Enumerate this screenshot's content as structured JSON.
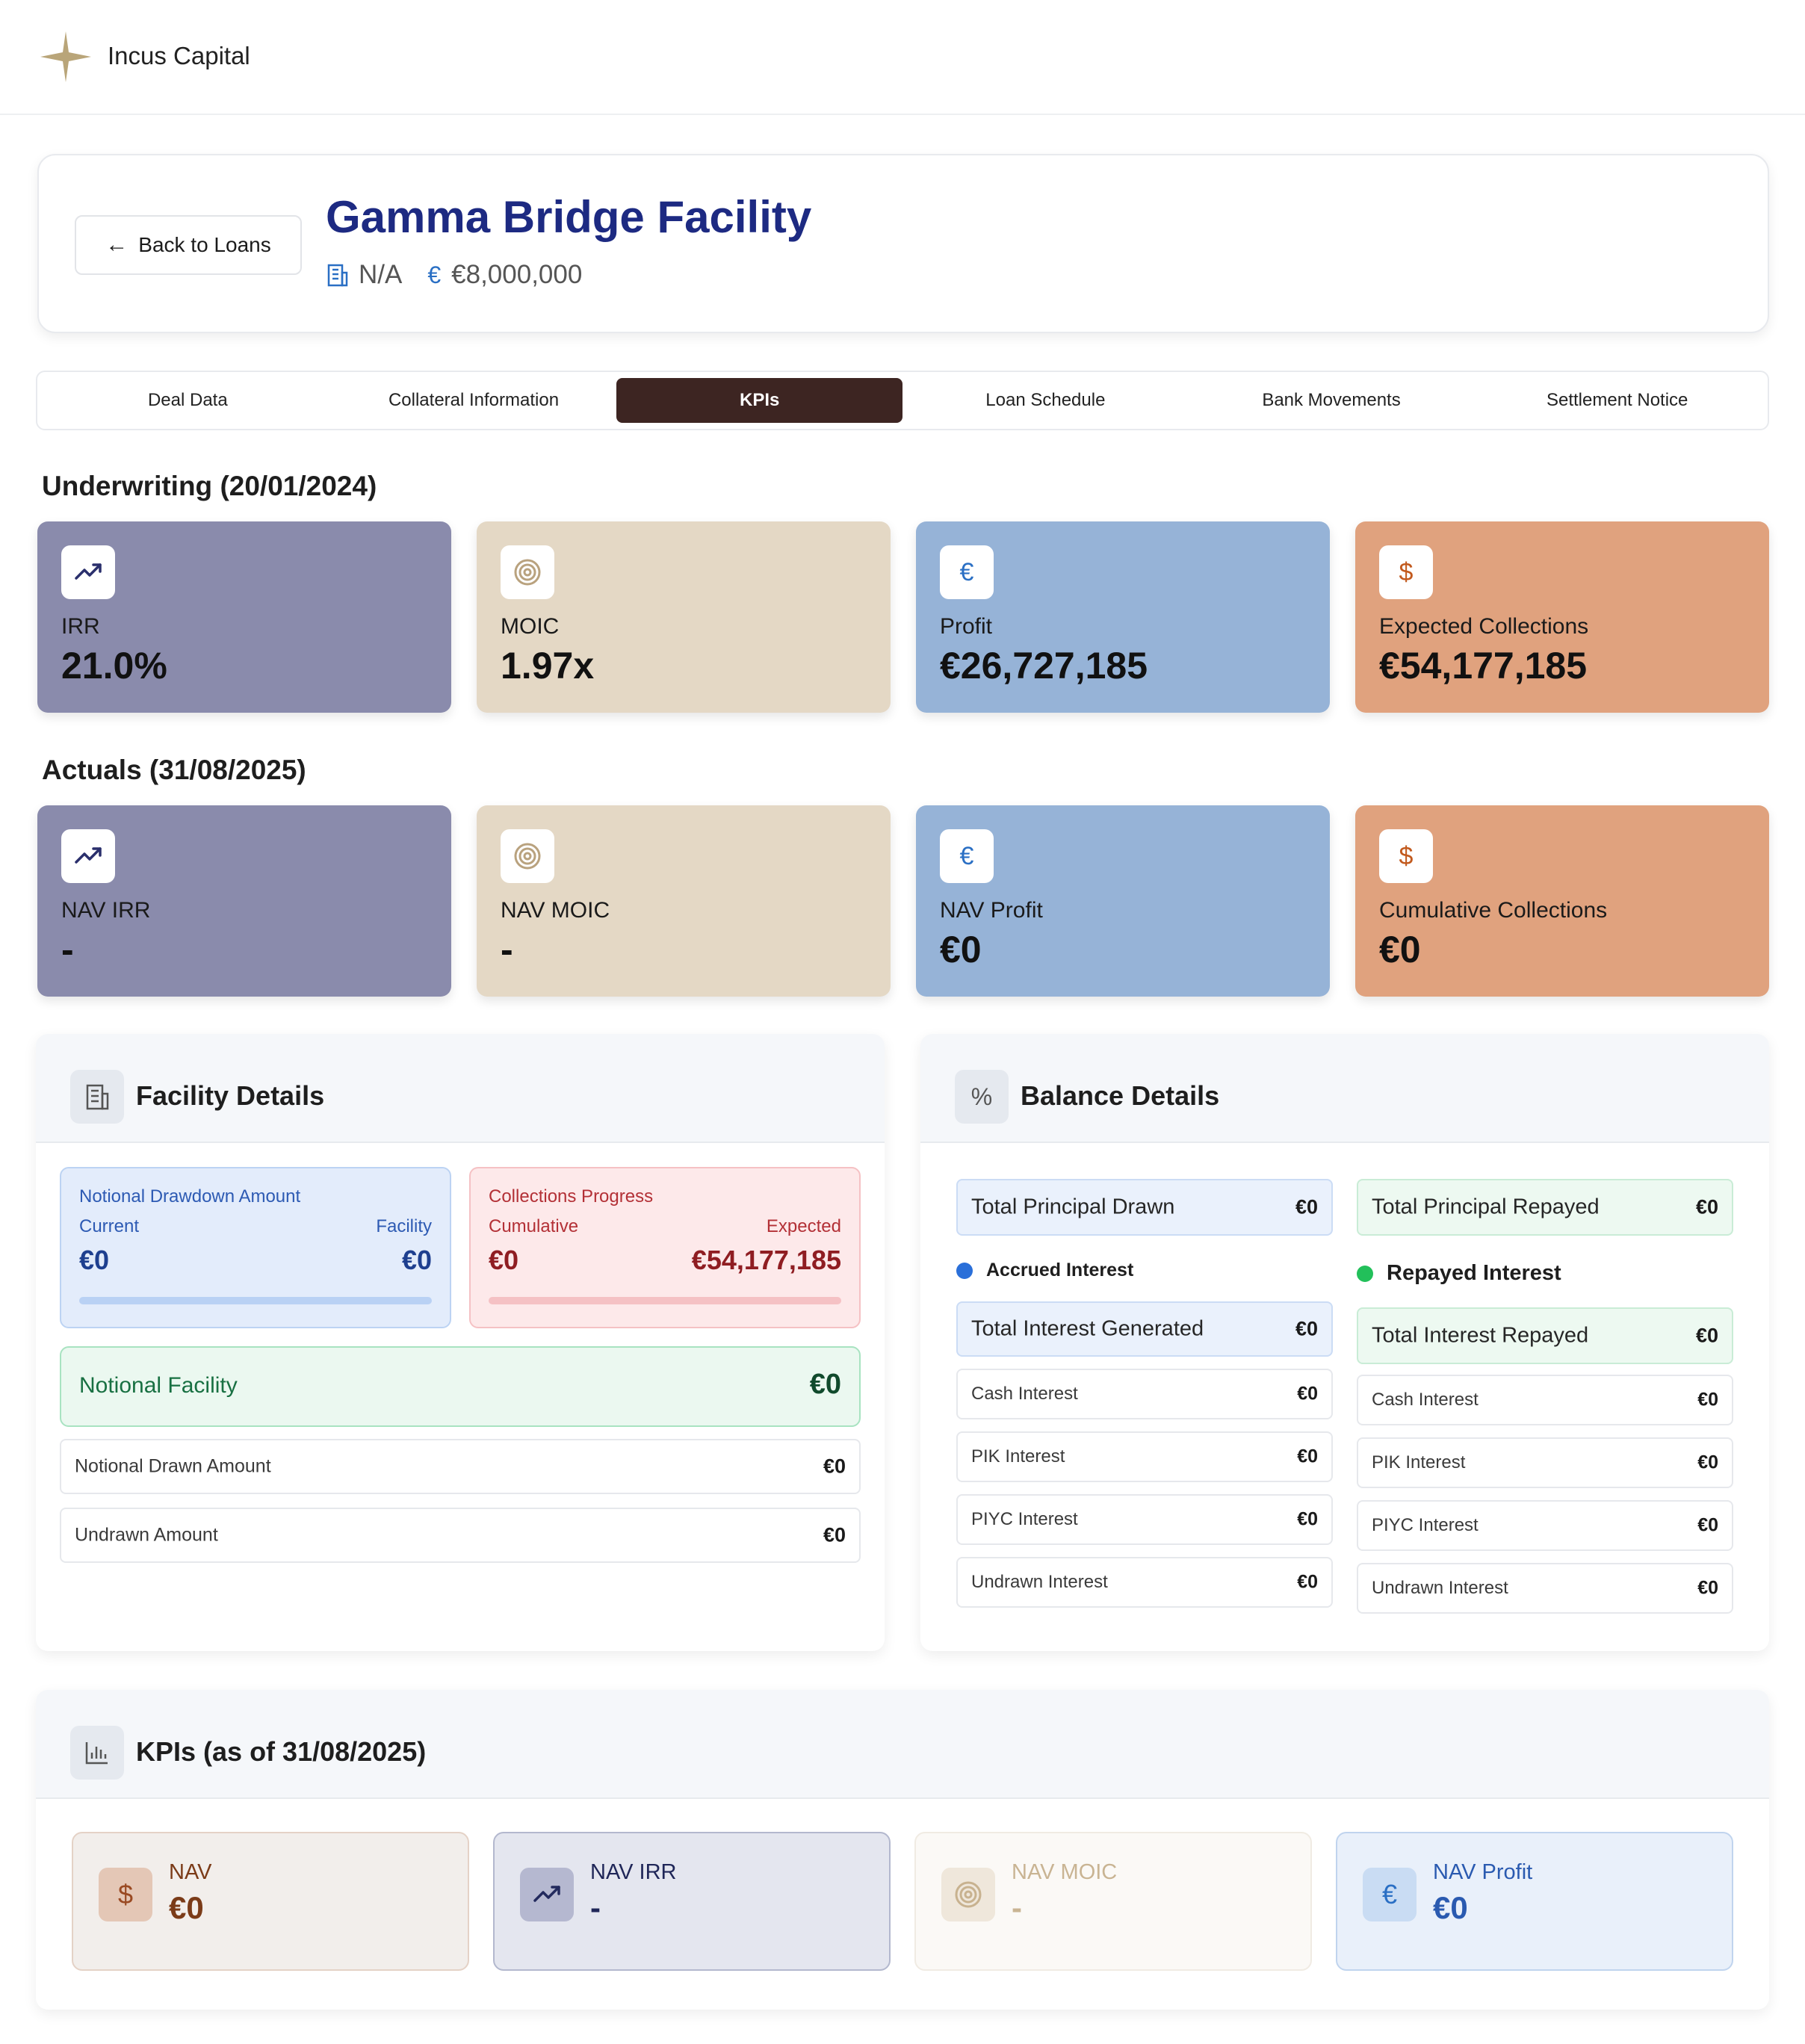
{
  "app": {
    "brand": "Incus Capital"
  },
  "header": {
    "back_label": "Back to Loans",
    "title": "Gamma Bridge Facility",
    "meta_code": "N/A",
    "meta_amount": "€8,000,000"
  },
  "tabs": [
    "Deal Data",
    "Collateral Information",
    "KPIs",
    "Loan Schedule",
    "Bank Movements",
    "Settlement Notice"
  ],
  "active_tab": "KPIs",
  "underwriting": {
    "heading": "Underwriting (20/01/2024)",
    "cards": [
      {
        "label": "IRR",
        "value": "21.0%",
        "icon": "trend-up-icon"
      },
      {
        "label": "MOIC",
        "value": "1.97x",
        "icon": "target-icon"
      },
      {
        "label": "Profit",
        "value": "€26,727,185",
        "icon": "euro-icon"
      },
      {
        "label": "Expected Collections",
        "value": "€54,177,185",
        "icon": "dollar-icon"
      }
    ]
  },
  "actuals": {
    "heading": "Actuals (31/08/2025)",
    "cards": [
      {
        "label": "NAV IRR",
        "value": "-",
        "icon": "trend-up-icon"
      },
      {
        "label": "NAV MOIC",
        "value": "-",
        "icon": "target-icon"
      },
      {
        "label": "NAV Profit",
        "value": "€0",
        "icon": "euro-icon"
      },
      {
        "label": "Cumulative Collections",
        "value": "€0",
        "icon": "dollar-icon"
      }
    ]
  },
  "facility": {
    "title": "Facility Details",
    "drawdown": {
      "title": "Notional Drawdown Amount",
      "left_sub": "Current",
      "right_sub": "Facility",
      "left_val": "€0",
      "right_val": "€0",
      "progress": 0
    },
    "collections": {
      "title": "Collections Progress",
      "left_sub": "Cumulative",
      "right_sub": "Expected",
      "left_val": "€0",
      "right_val": "€54,177,185",
      "progress": 0
    },
    "notional": {
      "label": "Notional Facility",
      "value": "€0"
    },
    "rows": [
      {
        "label": "Notional Drawn Amount",
        "value": "€0"
      },
      {
        "label": "Undrawn Amount",
        "value": "€0"
      }
    ]
  },
  "balance": {
    "title": "Balance Details",
    "principal_drawn": {
      "label": "Total Principal Drawn",
      "value": "€0"
    },
    "principal_repayed": {
      "label": "Total Principal Repayed",
      "value": "€0"
    },
    "accrued": {
      "heading": "Accrued Interest",
      "total": {
        "label": "Total Interest Generated",
        "value": "€0"
      },
      "rows": [
        {
          "label": "Cash Interest",
          "value": "€0"
        },
        {
          "label": "PIK Interest",
          "value": "€0"
        },
        {
          "label": "PIYC Interest",
          "value": "€0"
        },
        {
          "label": "Undrawn Interest",
          "value": "€0"
        }
      ]
    },
    "repayed": {
      "heading": "Repayed Interest",
      "total": {
        "label": "Total Interest Repayed",
        "value": "€0"
      },
      "rows": [
        {
          "label": "Cash Interest",
          "value": "€0"
        },
        {
          "label": "PIK Interest",
          "value": "€0"
        },
        {
          "label": "PIYC Interest",
          "value": "€0"
        },
        {
          "label": "Undrawn Interest",
          "value": "€0"
        }
      ]
    }
  },
  "kpis_asof": {
    "title": "KPIs (as of 31/08/2025)",
    "cards": [
      {
        "label": "NAV",
        "value": "€0",
        "icon": "dollar-icon"
      },
      {
        "label": "NAV IRR",
        "value": "-",
        "icon": "trend-up-icon"
      },
      {
        "label": "NAV MOIC",
        "value": "-",
        "icon": "target-icon"
      },
      {
        "label": "NAV Profit",
        "value": "€0",
        "icon": "euro-icon"
      }
    ]
  },
  "colors": {
    "brand_navy": "#1d2a82",
    "active_tab": "#3d2522",
    "accent_blue": "#2a6fc4"
  }
}
